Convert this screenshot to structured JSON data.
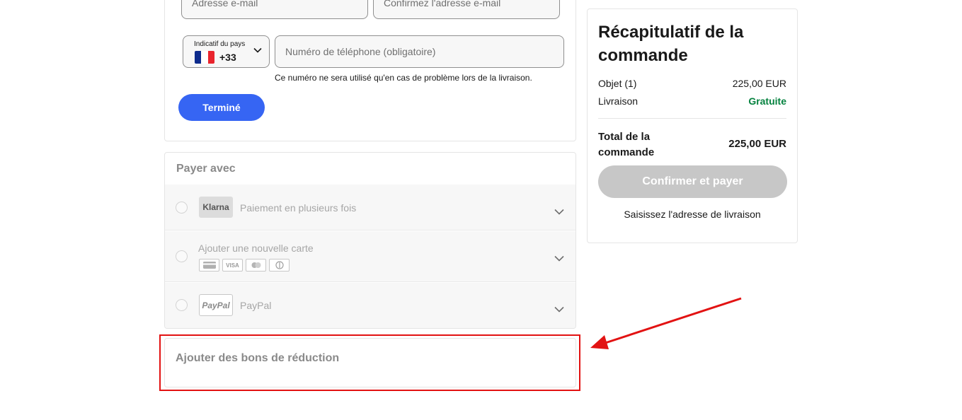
{
  "contact": {
    "email_placeholder": "Adresse e-mail",
    "email_confirm_placeholder": "Confirmez l'adresse e-mail",
    "country_code_label": "Indicatif du pays",
    "country_flag_icon": "france-flag-icon",
    "country_code_value": "+33",
    "phone_placeholder": "Numéro de téléphone (obligatoire)",
    "phone_hint": "Ce numéro ne sera utilisé qu'en cas de problème lors de la livraison.",
    "done_label": "Terminé"
  },
  "payment": {
    "title": "Payer avec",
    "options": [
      {
        "logo_text": "Klarna",
        "label": "Paiement en plusieurs fois"
      },
      {
        "label": "Ajouter une nouvelle carte",
        "card_icons": [
          "credit-card-icon",
          "VISA",
          "mastercard-icon",
          "diners-club-icon"
        ]
      },
      {
        "logo_text": "PayPal",
        "label": "PayPal"
      }
    ]
  },
  "coupon": {
    "title": "Ajouter des bons de réduction"
  },
  "summary": {
    "title": "Récapitulatif de la commande",
    "item_label": "Objet (1)",
    "item_value": "225,00 EUR",
    "shipping_label": "Livraison",
    "shipping_value": "Gratuite",
    "total_label": "Total de la commande",
    "total_value": "225,00 EUR",
    "pay_button_label": "Confirmer et payer",
    "hint": "Saisissez l'adresse de livraison"
  },
  "colors": {
    "primary_blue": "#3665f3",
    "disabled_gray": "#c7c7c7",
    "free_green": "#05823f",
    "annotation_red": "#e21212"
  }
}
